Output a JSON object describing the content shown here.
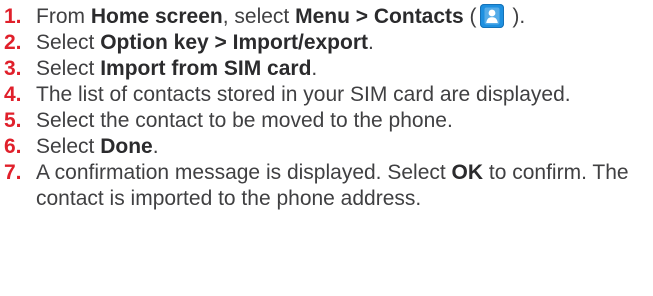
{
  "steps": [
    {
      "number": "1.",
      "parts": [
        "From ",
        "Home screen",
        ", select ",
        "Menu > Contacts",
        " (",
        " )."
      ],
      "icon": "contacts-icon"
    },
    {
      "number": "2.",
      "parts": [
        "Select ",
        "Option key > Import/export",
        "."
      ]
    },
    {
      "number": "3.",
      "parts": [
        "Select ",
        "Import from SIM card",
        "."
      ]
    },
    {
      "number": "4.",
      "parts": [
        "The list of contacts stored in your SIM card are displayed."
      ]
    },
    {
      "number": "5.",
      "parts": [
        "Select the contact to be moved to the phone."
      ]
    },
    {
      "number": "6.",
      "parts": [
        "Select ",
        "Done",
        "."
      ]
    },
    {
      "number": "7.",
      "parts": [
        "A confirmation message is displayed. Select ",
        "OK",
        " to confirm. The contact is imported to the phone address."
      ]
    }
  ],
  "colors": {
    "number": "#e0202b",
    "text": "#404042",
    "icon_background": "#1e90e0"
  }
}
